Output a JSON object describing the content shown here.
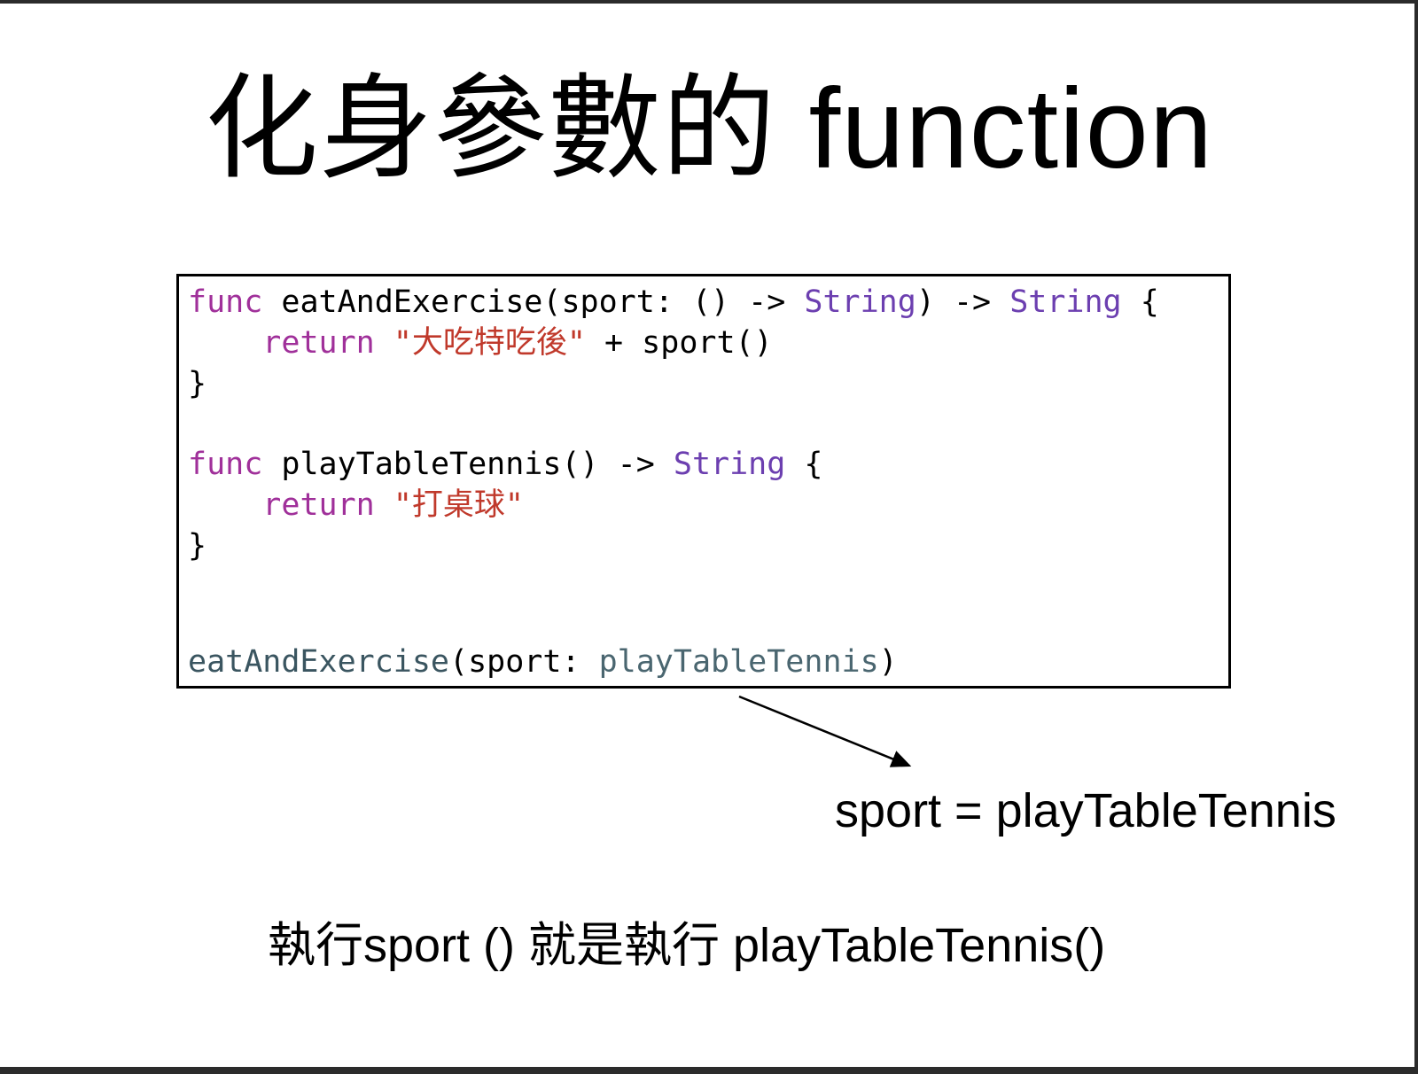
{
  "slide": {
    "title": "化身參數的 function",
    "code": {
      "line1": {
        "kw": "func",
        "name": " eatAndExercise(sport: () -> ",
        "type1": "String",
        "mid": ") -> ",
        "type2": "String",
        "end": " {"
      },
      "line2": {
        "indent": "    ",
        "kw": "return",
        "sp": " ",
        "str": "\"大吃特吃後\"",
        "rest": " + sport()"
      },
      "line3": {
        "text": "}"
      },
      "line5": {
        "kw": "func",
        "name": " playTableTennis() -> ",
        "type": "String",
        "end": " {"
      },
      "line6": {
        "indent": "    ",
        "kw": "return",
        "sp": " ",
        "str": "\"打桌球\""
      },
      "line7": {
        "text": "}"
      },
      "line10": {
        "fn": "eatAndExercise",
        "mid": "(sport: ",
        "arg": "playTableTennis",
        "end": ")"
      }
    },
    "annotation": "sport = playTableTennis",
    "explanation": "執行sport () 就是執行 playTableTennis()"
  },
  "colors": {
    "keyword": "#a0309a",
    "type": "#6c3fb0",
    "string": "#c0392b",
    "call": "#3a5560"
  }
}
